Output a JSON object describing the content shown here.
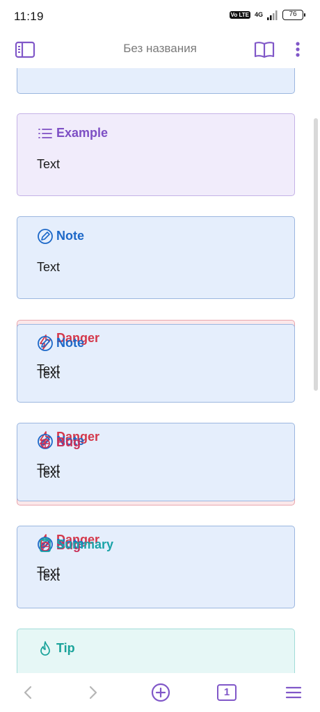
{
  "status": {
    "time": "11:19",
    "volte": "Vo LTE",
    "network": "4G",
    "battery": "76"
  },
  "toolbar": {
    "title": "Без названия"
  },
  "callouts": {
    "note_label": "Note",
    "example_label": "Example",
    "danger_label": "Danger",
    "bug_label": "Bug",
    "summary_label": "Summary",
    "tip_label": "Tip",
    "body_text": "Text"
  },
  "bottom": {
    "tabs_count": "1"
  },
  "colors": {
    "accent": "#8057c8",
    "note": "#1d68c8",
    "example": "#7d4fc4",
    "danger": "#d4374a",
    "tip": "#1aa39a"
  }
}
